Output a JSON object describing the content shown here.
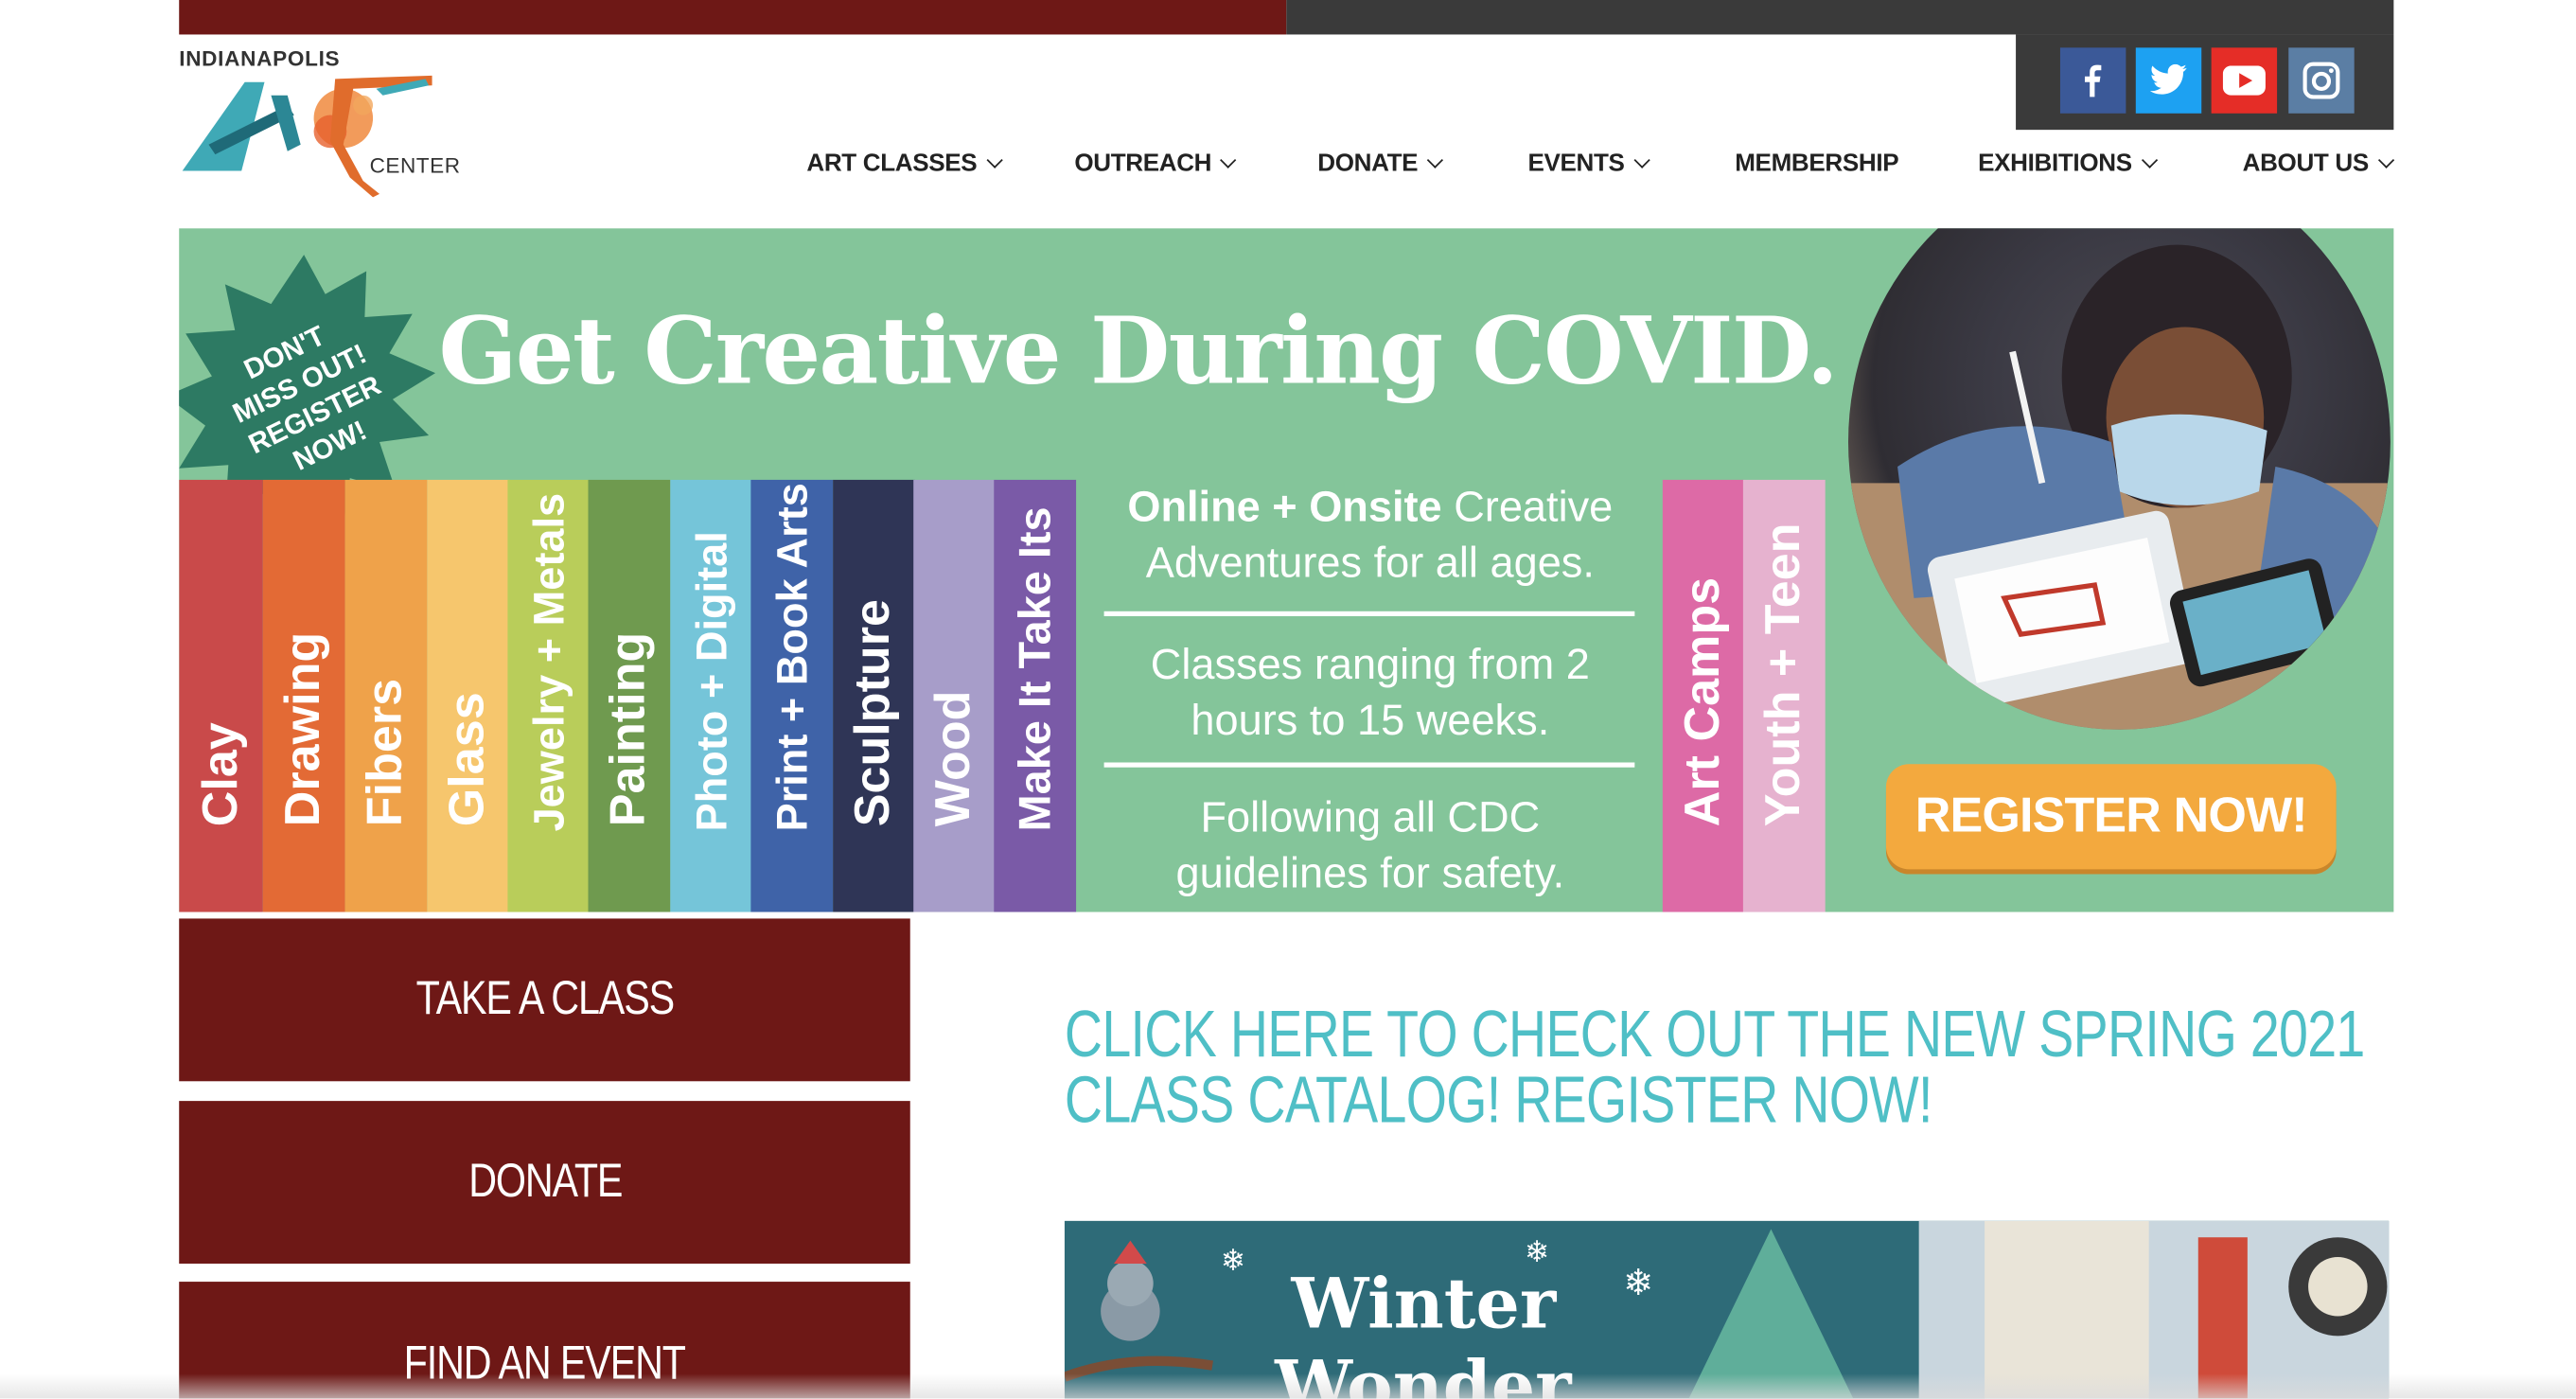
{
  "logo": {
    "top": "INDIANAPOLIS",
    "mark": "ART",
    "bottom": "CENTER"
  },
  "social": [
    {
      "name": "facebook",
      "color": "#3b5998",
      "glyph": "f"
    },
    {
      "name": "twitter",
      "color": "#1da1f2",
      "glyph": "t"
    },
    {
      "name": "youtube",
      "color": "#e52d27",
      "glyph": "▶"
    },
    {
      "name": "instagram",
      "color": "#5b7ea4",
      "glyph": "◎"
    }
  ],
  "nav": [
    {
      "label": "ART CLASSES",
      "dropdown": true
    },
    {
      "label": "OUTREACH",
      "dropdown": true
    },
    {
      "label": "DONATE",
      "dropdown": true
    },
    {
      "label": "EVENTS",
      "dropdown": true
    },
    {
      "label": "MEMBERSHIP",
      "dropdown": false
    },
    {
      "label": "EXHIBITIONS",
      "dropdown": true
    },
    {
      "label": "ABOUT US",
      "dropdown": true
    }
  ],
  "banner": {
    "headline": "Get Creative During COVID.",
    "starburst": [
      "DON'T",
      "MISS OUT!",
      "REGISTER",
      "NOW!"
    ],
    "stripes": [
      "Clay",
      "Drawing",
      "Fibers",
      "Glass",
      "Jewelry + Metals",
      "Painting",
      "Photo + Digital",
      "Print + Book Arts",
      "Sculpture",
      "Wood",
      "Make It Take Its"
    ],
    "stripes_right": [
      "Art Camps",
      "Youth + Teen"
    ],
    "info_bold": "Online + Onsite",
    "info1_rest": " Creative Adventures for all ages.",
    "info2": "Classes ranging from 2 hours to 15 weeks.",
    "info3": "Following all CDC guidelines for safety.",
    "register_label": "REGISTER NOW!"
  },
  "side_buttons": [
    "TAKE A CLASS",
    "DONATE",
    "FIND AN EVENT"
  ],
  "catalog": {
    "line1": "CLICK HERE TO CHECK OUT THE NEW SPRING 2021",
    "line2": "CLASS CATALOG! REGISTER NOW!"
  },
  "winter": {
    "line1": "Winter",
    "line2": "Wonder"
  },
  "colors": {
    "maroon": "#6e1816",
    "dark": "#3a3a3a",
    "banner_green": "#84c59a",
    "teal_text": "#4fbfc6",
    "register_orange": "#f3a93e"
  }
}
